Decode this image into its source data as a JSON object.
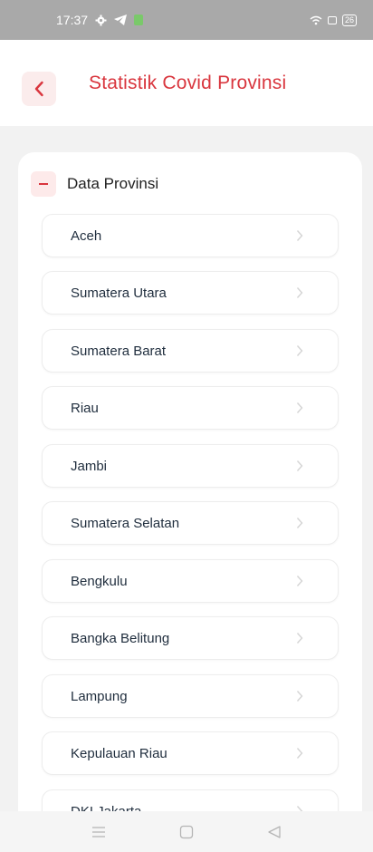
{
  "status_bar": {
    "time": "17:37",
    "battery": "26"
  },
  "header": {
    "title": "Statistik Covid Provinsi"
  },
  "section": {
    "title": "Data Provinsi"
  },
  "provinces": [
    {
      "label": "Aceh"
    },
    {
      "label": "Sumatera Utara"
    },
    {
      "label": "Sumatera Barat"
    },
    {
      "label": "Riau"
    },
    {
      "label": "Jambi"
    },
    {
      "label": "Sumatera Selatan"
    },
    {
      "label": "Bengkulu"
    },
    {
      "label": "Bangka Belitung"
    },
    {
      "label": "Lampung"
    },
    {
      "label": "Kepulauan Riau"
    },
    {
      "label": "DKI Jakarta"
    }
  ],
  "colors": {
    "accent": "#d9363e",
    "accent_bg": "#fbecec",
    "status_bar": "#a9a9a9"
  },
  "icons": {
    "back": "chevron-left-icon",
    "collapse": "minus-icon",
    "item_arrow": "chevron-right-icon",
    "nav_recent": "menu-icon",
    "nav_home": "square-icon",
    "nav_back": "triangle-back-icon"
  }
}
